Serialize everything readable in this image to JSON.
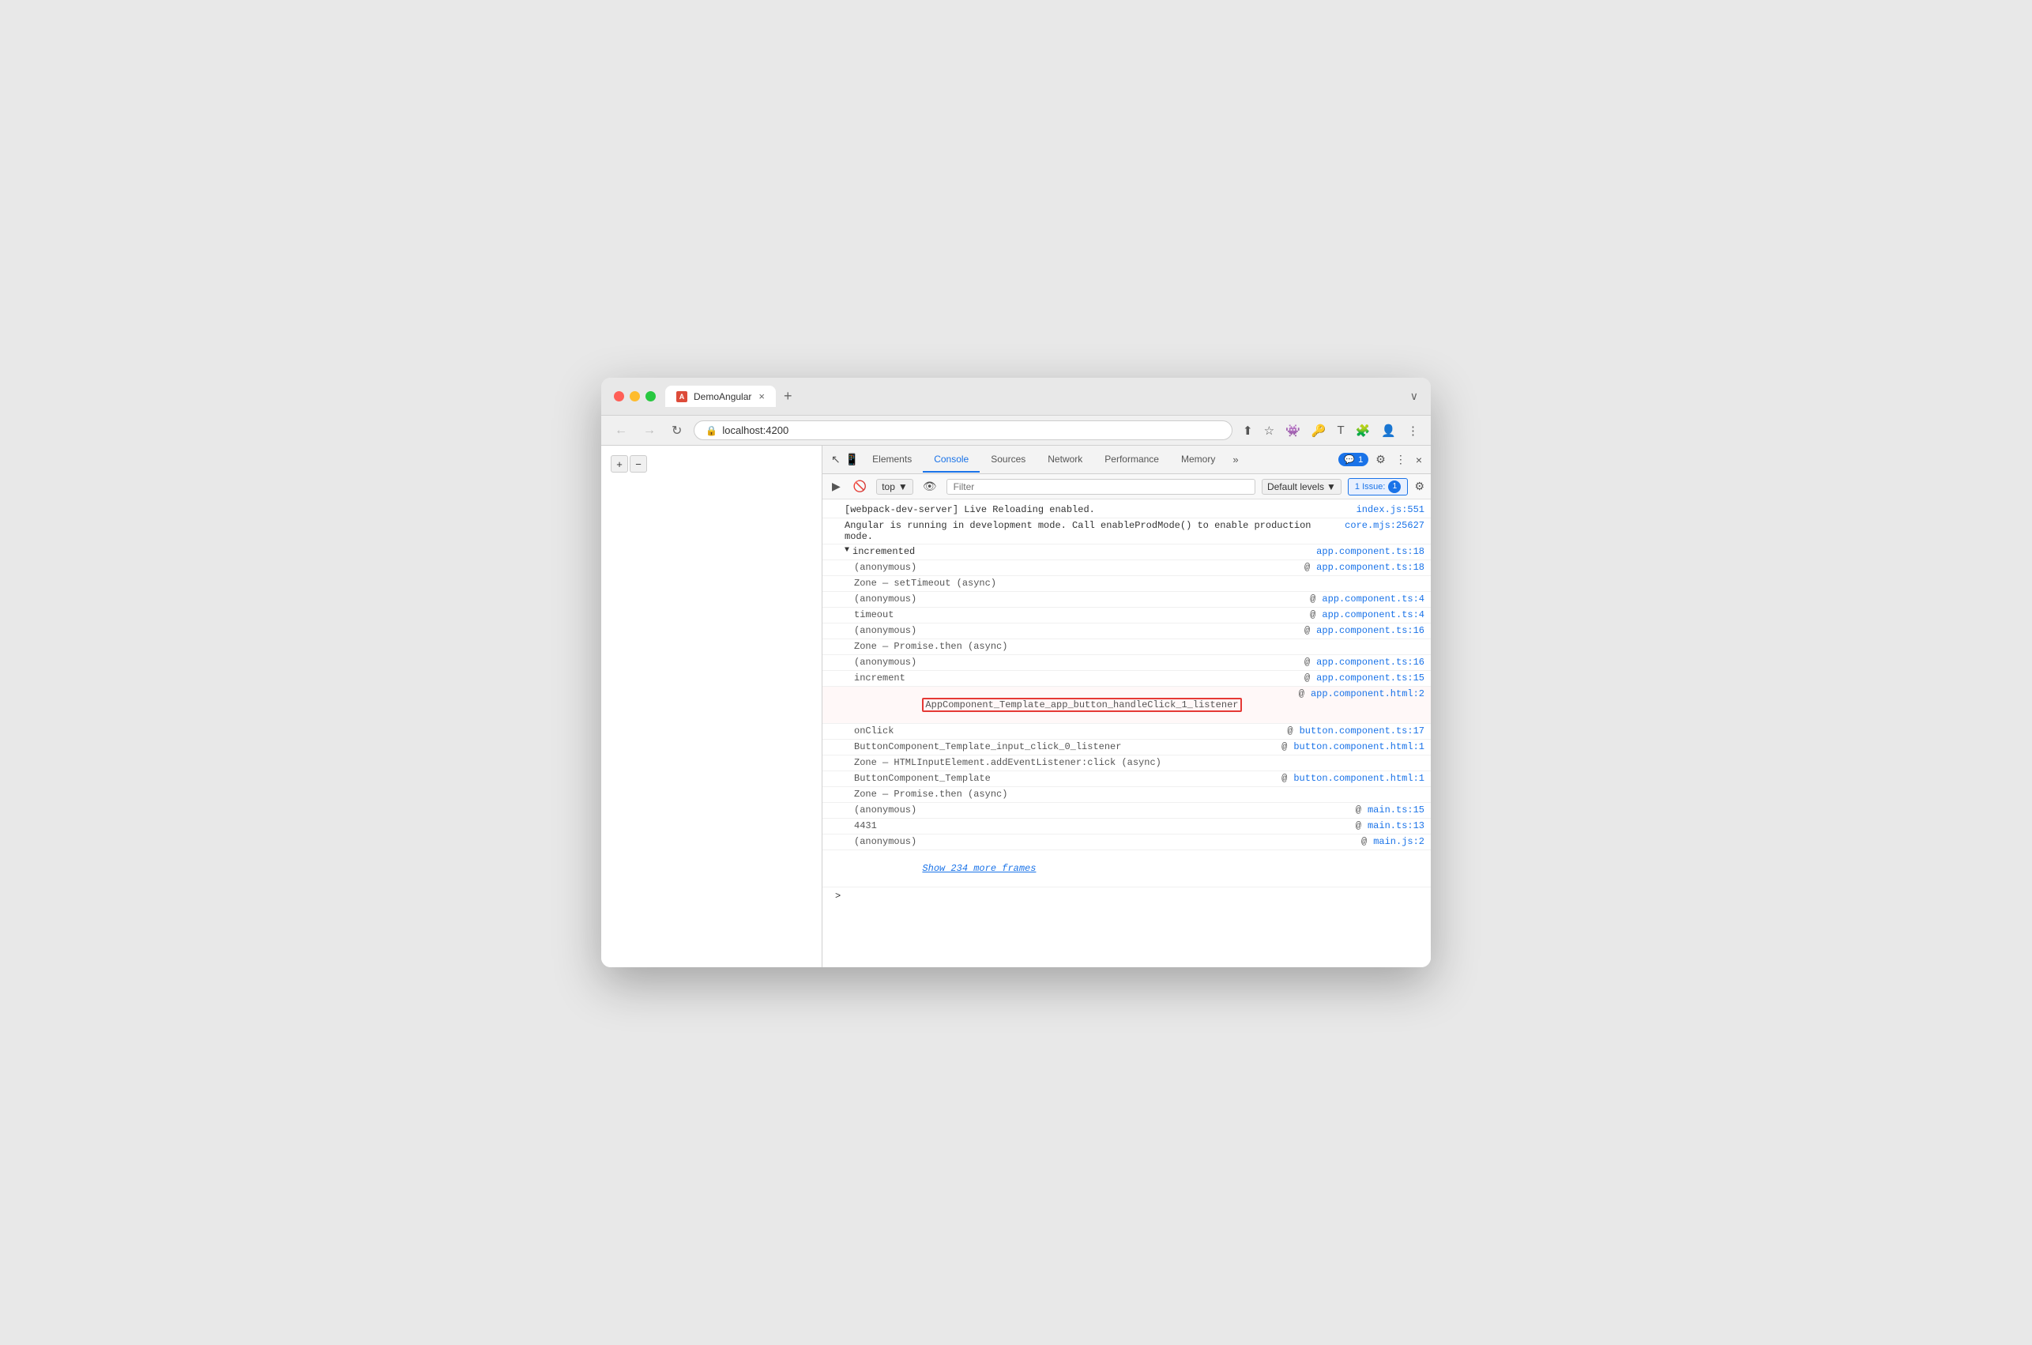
{
  "browser": {
    "tab_title": "DemoAngular",
    "tab_close": "×",
    "new_tab": "+",
    "window_expand": "∨",
    "address": "localhost:4200",
    "back_btn": "←",
    "forward_btn": "→",
    "refresh_btn": "↻"
  },
  "devtools": {
    "tabs": [
      "Elements",
      "Console",
      "Sources",
      "Network",
      "Performance",
      "Memory"
    ],
    "active_tab": "Console",
    "more_btn": "»",
    "badge_icon": "💬",
    "badge_count": "1",
    "settings_icon": "⚙",
    "more_vert": "⋮",
    "close_btn": "×"
  },
  "console_toolbar": {
    "play_btn": "▶",
    "block_btn": "🚫",
    "top_label": "top",
    "top_arrow": "▼",
    "eye_btn": "👁",
    "filter_placeholder": "Filter",
    "default_levels": "Default levels",
    "default_levels_arrow": "▼",
    "issue_label": "1 Issue:",
    "issue_count": "1",
    "settings_icon": "⚙"
  },
  "console_rows": [
    {
      "type": "normal",
      "content": "[webpack-dev-server] Live Reloading enabled.",
      "link": "index.js:551",
      "indented": false,
      "highlighted": false
    },
    {
      "type": "normal",
      "content": "Angular is running in development mode. Call enableProdMode() to enable production\nmode.",
      "link": "core.mjs:25627",
      "indented": false,
      "highlighted": false
    },
    {
      "type": "triangle",
      "content": "incremented",
      "link": "app.component.ts:18",
      "indented": false,
      "highlighted": false
    },
    {
      "type": "normal",
      "content": "(anonymous)",
      "link": "app.component.ts:18",
      "indented": true,
      "highlighted": false
    },
    {
      "type": "normal",
      "content": "Zone — setTimeout (async)",
      "link": "",
      "indented": true,
      "highlighted": false
    },
    {
      "type": "normal",
      "content": "(anonymous)",
      "link": "app.component.ts:4",
      "indented": true,
      "highlighted": false
    },
    {
      "type": "normal",
      "content": "timeout",
      "link": "app.component.ts:4",
      "indented": true,
      "highlighted": false
    },
    {
      "type": "normal",
      "content": "(anonymous)",
      "link": "app.component.ts:16",
      "indented": true,
      "highlighted": false
    },
    {
      "type": "normal",
      "content": "Zone — Promise.then (async)",
      "link": "",
      "indented": true,
      "highlighted": false
    },
    {
      "type": "normal",
      "content": "(anonymous)",
      "link": "app.component.ts:16",
      "indented": true,
      "highlighted": false
    },
    {
      "type": "normal",
      "content": "increment",
      "link": "app.component.ts:15",
      "indented": true,
      "highlighted": false
    },
    {
      "type": "normal",
      "content": "AppComponent_Template_app_button_handleClick_1_listener",
      "link": "app.component.html:2",
      "indented": true,
      "highlighted": true
    },
    {
      "type": "normal",
      "content": "onClick",
      "link": "button.component.ts:17",
      "indented": true,
      "highlighted": false
    },
    {
      "type": "normal",
      "content": "ButtonComponent_Template_input_click_0_listener",
      "link": "button.component.html:1",
      "indented": true,
      "highlighted": false
    },
    {
      "type": "normal",
      "content": "Zone — HTMLInputElement.addEventListener:click (async)",
      "link": "",
      "indented": true,
      "highlighted": false
    },
    {
      "type": "normal",
      "content": "ButtonComponent_Template",
      "link": "button.component.html:1",
      "indented": true,
      "highlighted": false
    },
    {
      "type": "normal",
      "content": "Zone — Promise.then (async)",
      "link": "",
      "indented": true,
      "highlighted": false
    },
    {
      "type": "normal",
      "content": "(anonymous)",
      "link": "main.ts:15",
      "indented": true,
      "highlighted": false
    },
    {
      "type": "normal",
      "content": "4431",
      "link": "main.ts:13",
      "indented": true,
      "highlighted": false
    },
    {
      "type": "normal",
      "content": "(anonymous)",
      "link": "main.js:2",
      "indented": true,
      "highlighted": false
    },
    {
      "type": "show-more",
      "content": "Show 234 more frames",
      "link": "",
      "indented": true,
      "highlighted": false
    }
  ],
  "zoom_controls": {
    "plus_label": "+",
    "minus_label": "−"
  }
}
